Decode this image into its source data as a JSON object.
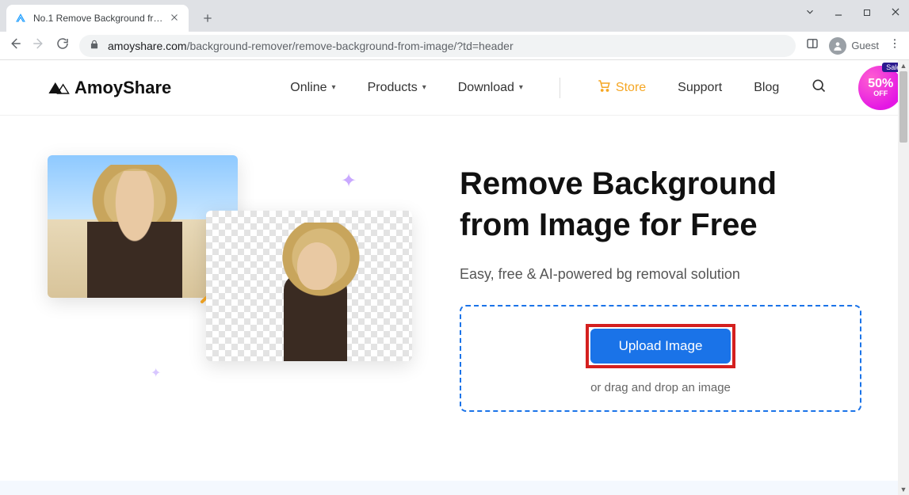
{
  "browser": {
    "tab_title": "No.1 Remove Background from I",
    "guest_label": "Guest",
    "url_domain": "amoyshare.com",
    "url_path": "/background-remover/remove-background-from-image/?td=header"
  },
  "header": {
    "brand": "AmoyShare",
    "nav": {
      "online": "Online",
      "products": "Products",
      "download": "Download",
      "store": "Store",
      "support": "Support",
      "blog": "Blog"
    },
    "sale": {
      "tag": "Sale",
      "percent": "50%",
      "off": "OFF"
    }
  },
  "hero": {
    "title_line1": "Remove Background",
    "title_line2": "from Image for Free",
    "subtitle": "Easy, free & AI-powered bg removal solution",
    "upload_label": "Upload Image",
    "drop_hint": "or drag and drop an image"
  }
}
